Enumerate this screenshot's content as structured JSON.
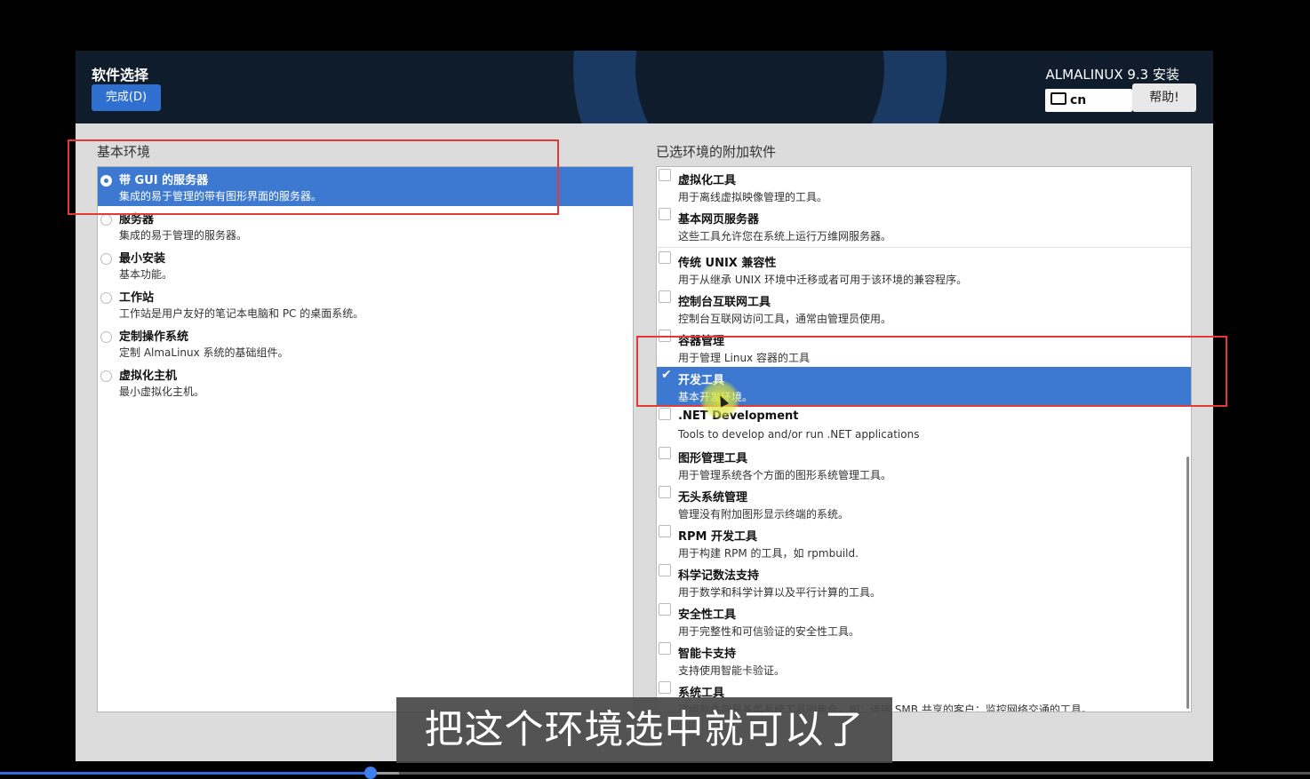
{
  "header": {
    "page_title": "软件选择",
    "done_label": "完成(D)",
    "product_title": "ALMALINUX 9.3 安装",
    "keyboard_layout": "cn",
    "keyboard_icon": "keyboard-icon",
    "help_label": "帮助!"
  },
  "base_environment": {
    "label": "基本环境",
    "items": [
      {
        "title": "带 GUI 的服务器",
        "desc": "集成的易于管理的带有图形界面的服务器。",
        "selected": true
      },
      {
        "title": "服务器",
        "desc": "集成的易于管理的服务器。",
        "selected": false
      },
      {
        "title": "最小安装",
        "desc": "基本功能。",
        "selected": false
      },
      {
        "title": "工作站",
        "desc": "工作站是用户友好的笔记本电脑和 PC 的桌面系统。",
        "selected": false
      },
      {
        "title": "定制操作系统",
        "desc": "定制 AlmaLinux 系统的基础组件。",
        "selected": false
      },
      {
        "title": "虚拟化主机",
        "desc": "最小虚拟化主机。",
        "selected": false
      }
    ]
  },
  "addons": {
    "label": "已选环境的附加软件",
    "items": [
      {
        "title": "虚拟化工具",
        "desc": "用于离线虚拟映像管理的工具。",
        "checked": false
      },
      {
        "title": "基本网页服务器",
        "desc": "这些工具允许您在系统上运行万维网服务器。",
        "checked": false
      },
      {
        "title": "传统 UNIX 兼容性",
        "desc": "用于从继承 UNIX 环境中迁移或者可用于该环境的兼容程序。",
        "checked": false
      },
      {
        "title": "控制台互联网工具",
        "desc": "控制台互联网访问工具，通常由管理员使用。",
        "checked": false
      },
      {
        "title": "容器管理",
        "desc": "用于管理 Linux 容器的工具",
        "checked": false
      },
      {
        "title": "开发工具",
        "desc": "基本开发环境。",
        "checked": true
      },
      {
        "title": ".NET Development",
        "desc": "Tools to develop and/or run .NET applications",
        "checked": false
      },
      {
        "title": "图形管理工具",
        "desc": "用于管理系统各个方面的图形系统管理工具。",
        "checked": false
      },
      {
        "title": "无头系统管理",
        "desc": "管理没有附加图形显示终端的系统。",
        "checked": false
      },
      {
        "title": "RPM 开发工具",
        "desc": "用于构建 RPM 的工具，如 rpmbuild.",
        "checked": false
      },
      {
        "title": "科学记数法支持",
        "desc": "用于数学和科学计算以及平行计算的工具。",
        "checked": false
      },
      {
        "title": "安全性工具",
        "desc": "用于完整性和可信验证的安全性工具。",
        "checked": false
      },
      {
        "title": "智能卡支持",
        "desc": "支持使用智能卡验证。",
        "checked": false
      },
      {
        "title": "系统工具",
        "desc": "这组软件包是各类系统工具的集合，如：连接 SMB 共享的客户；监控网络交通的工具。",
        "checked": false
      }
    ]
  },
  "subtitle": "把这个环境选中就可以了",
  "video_progress": 0.283,
  "colors": {
    "selection": "#3d79d0",
    "highlight_box": "#e53935",
    "header_bg": "#0f1c2c"
  }
}
